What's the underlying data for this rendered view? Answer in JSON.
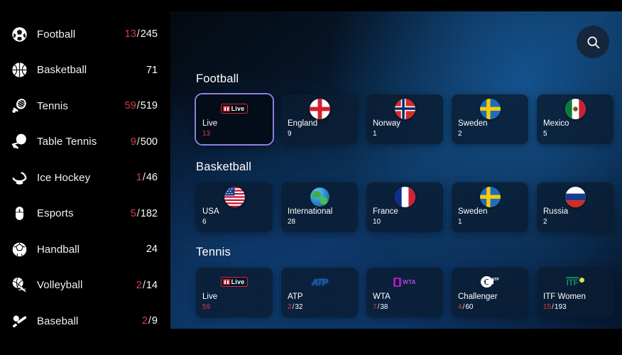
{
  "sidebar": {
    "items": [
      {
        "label": "Football",
        "icon": "soccer-ball-icon",
        "live": "13",
        "sep": "/",
        "total": "245"
      },
      {
        "label": "Basketball",
        "icon": "basketball-icon",
        "live": "",
        "sep": "",
        "total": "71"
      },
      {
        "label": "Tennis",
        "icon": "tennis-racket-icon",
        "live": "59",
        "sep": "/",
        "total": "519"
      },
      {
        "label": "Table Tennis",
        "icon": "ping-pong-paddle-icon",
        "live": "9",
        "sep": "/",
        "total": "500"
      },
      {
        "label": "Ice Hockey",
        "icon": "hockey-stick-icon",
        "live": "1",
        "sep": "/",
        "total": "46"
      },
      {
        "label": "Esports",
        "icon": "computer-mouse-icon",
        "live": "5",
        "sep": "/",
        "total": "182"
      },
      {
        "label": "Handball",
        "icon": "handball-icon",
        "live": "",
        "sep": "",
        "total": "24"
      },
      {
        "label": "Volleyball",
        "icon": "volleyball-net-icon",
        "live": "2",
        "sep": "/",
        "total": "14"
      },
      {
        "label": "Baseball",
        "icon": "baseball-bat-icon",
        "live": "2",
        "sep": "/",
        "total": "9"
      }
    ]
  },
  "header": {
    "search_icon": "search-icon"
  },
  "colors": {
    "live_red": "#d93b4a",
    "focus_border": "#8b82e0",
    "card_bg": "#0a1b31",
    "text": "#ffffff"
  },
  "main": {
    "sections": [
      {
        "title": "Football",
        "cards": [
          {
            "name": "Live",
            "art": "live-badge",
            "live": "13",
            "sep": "",
            "total": "",
            "focused": true
          },
          {
            "name": "England",
            "art": "flag-england",
            "live": "",
            "sep": "",
            "total": "9",
            "focused": false
          },
          {
            "name": "Norway",
            "art": "flag-norway",
            "live": "",
            "sep": "",
            "total": "1",
            "focused": false
          },
          {
            "name": "Sweden",
            "art": "flag-sweden",
            "live": "",
            "sep": "",
            "total": "2",
            "focused": false
          },
          {
            "name": "Mexico",
            "art": "flag-mexico",
            "live": "",
            "sep": "",
            "total": "5",
            "focused": false
          }
        ]
      },
      {
        "title": "Basketball",
        "cards": [
          {
            "name": "USA",
            "art": "flag-usa",
            "live": "",
            "sep": "",
            "total": "6",
            "focused": false
          },
          {
            "name": "International",
            "art": "globe-icon",
            "live": "",
            "sep": "",
            "total": "28",
            "focused": false
          },
          {
            "name": "France",
            "art": "flag-france",
            "live": "",
            "sep": "",
            "total": "10",
            "focused": false
          },
          {
            "name": "Sweden",
            "art": "flag-sweden",
            "live": "",
            "sep": "",
            "total": "1",
            "focused": false
          },
          {
            "name": "Russia",
            "art": "flag-russia",
            "live": "",
            "sep": "",
            "total": "2",
            "focused": false
          }
        ]
      },
      {
        "title": "Tennis",
        "cards": [
          {
            "name": "Live",
            "art": "live-badge",
            "live": "59",
            "sep": "",
            "total": "",
            "focused": false
          },
          {
            "name": "ATP",
            "art": "atp-logo",
            "live": "2",
            "sep": "/",
            "total": "32",
            "focused": false
          },
          {
            "name": "WTA",
            "art": "wta-logo",
            "live": "7",
            "sep": "/",
            "total": "38",
            "focused": false
          },
          {
            "name": "Challenger",
            "art": "challenger-logo",
            "live": "4",
            "sep": "/",
            "total": "60",
            "focused": false
          },
          {
            "name": "ITF Women",
            "art": "itf-logo",
            "live": "15",
            "sep": "/",
            "total": "193",
            "focused": false
          }
        ]
      }
    ]
  }
}
